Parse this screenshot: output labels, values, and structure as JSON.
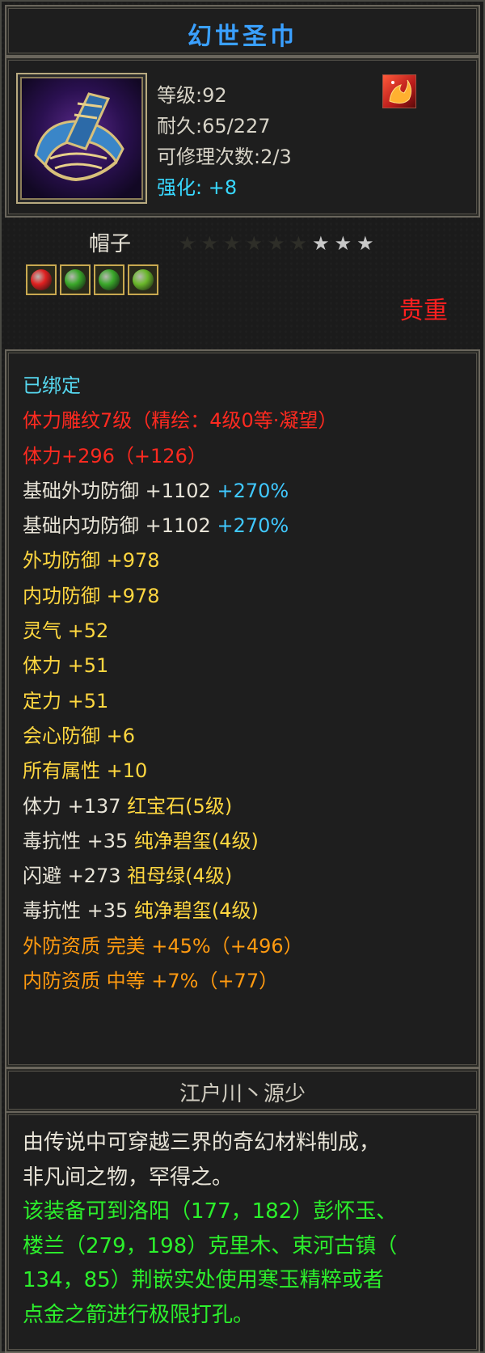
{
  "item": {
    "name": "幻世圣巾",
    "icon": "headband-icon",
    "badge_icon": "fire-bird-icon"
  },
  "stats": {
    "level": "等级:92",
    "durability": "耐久:65/227",
    "repairs": "可修理次数:2/3",
    "enhance": "强化: +8"
  },
  "type_label": "帽子",
  "stars": {
    "total": 9,
    "lit": 3
  },
  "gem_slots": [
    {
      "name": "ruby-gem-icon",
      "color": "#e02020"
    },
    {
      "name": "jade-gem-icon",
      "color": "#3aa82a"
    },
    {
      "name": "jade-gem-icon",
      "color": "#3aa82a"
    },
    {
      "name": "emerald-gem-icon",
      "color": "#6ab82a"
    }
  ],
  "rarity": "贵重",
  "attributes": [
    {
      "parts": [
        {
          "text": "已绑定",
          "color": "cyan"
        }
      ]
    },
    {
      "parts": [
        {
          "text": "体力雕纹7级（精绘：4级0等·凝望）",
          "color": "red"
        }
      ]
    },
    {
      "parts": [
        {
          "text": "体力+296（+126）",
          "color": "red"
        }
      ]
    },
    {
      "parts": [
        {
          "text": "基础外功防御 +1102 ",
          "color": "white"
        },
        {
          "text": "+270%",
          "color": "blue"
        }
      ]
    },
    {
      "parts": [
        {
          "text": "基础内功防御 +1102 ",
          "color": "white"
        },
        {
          "text": "+270%",
          "color": "blue"
        }
      ]
    },
    {
      "parts": [
        {
          "text": "外功防御 +978",
          "color": "yellow"
        }
      ]
    },
    {
      "parts": [
        {
          "text": "内功防御 +978",
          "color": "yellow"
        }
      ]
    },
    {
      "parts": [
        {
          "text": "灵气 +52",
          "color": "yellow"
        }
      ]
    },
    {
      "parts": [
        {
          "text": "体力 +51",
          "color": "yellow"
        }
      ]
    },
    {
      "parts": [
        {
          "text": "定力 +51",
          "color": "yellow"
        }
      ]
    },
    {
      "parts": [
        {
          "text": "会心防御 +6",
          "color": "yellow"
        }
      ]
    },
    {
      "parts": [
        {
          "text": "所有属性 +10",
          "color": "yellow"
        }
      ]
    },
    {
      "parts": [
        {
          "text": "体力 +137 ",
          "color": "white"
        },
        {
          "text": "红宝石(5级)",
          "color": "yellow"
        }
      ]
    },
    {
      "parts": [
        {
          "text": "毒抗性 +35 ",
          "color": "white"
        },
        {
          "text": "纯净碧玺(4级)",
          "color": "yellow"
        }
      ]
    },
    {
      "parts": [
        {
          "text": "闪避 +273 ",
          "color": "white"
        },
        {
          "text": "祖母绿(4级)",
          "color": "yellow"
        }
      ]
    },
    {
      "parts": [
        {
          "text": "毒抗性 +35 ",
          "color": "white"
        },
        {
          "text": "纯净碧玺(4级)",
          "color": "yellow"
        }
      ]
    },
    {
      "parts": [
        {
          "text": "外防资质  完美 +45%（+496）",
          "color": "orange"
        }
      ]
    },
    {
      "parts": [
        {
          "text": "内防资质  中等 +7%（+77）",
          "color": "orange"
        }
      ]
    }
  ],
  "source": "江户川丶源少",
  "description": [
    {
      "text": "由传说中可穿越三界的奇幻材料制成，",
      "color": "white"
    },
    {
      "text": "非凡间之物，罕得之。",
      "color": "white"
    },
    {
      "text": "该装备可到洛阳（177，182）彭怀玉、",
      "color": "green"
    },
    {
      "text": "楼兰（279，198）克里木、束河古镇（",
      "color": "green"
    },
    {
      "text": "134，85）荆嵌实处使用寒玉精粹或者",
      "color": "green"
    },
    {
      "text": "点金之箭进行极限打孔。",
      "color": "green"
    }
  ]
}
